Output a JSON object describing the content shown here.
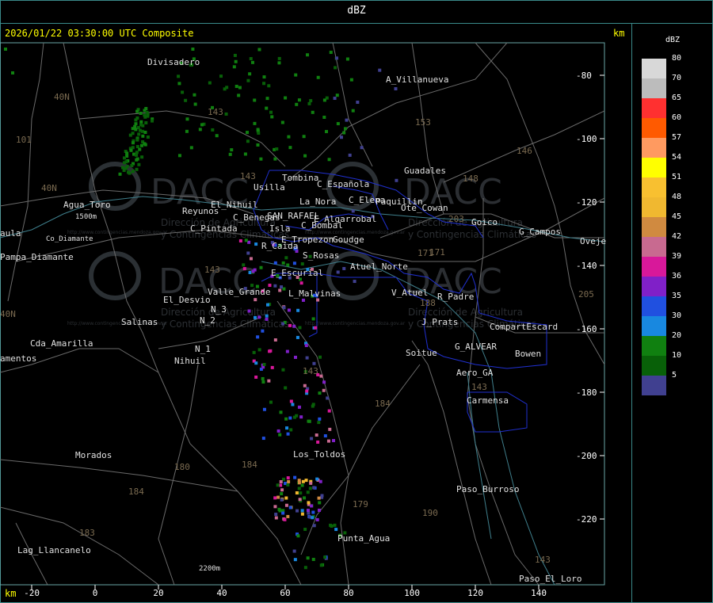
{
  "header": {
    "title": "dBZ"
  },
  "map": {
    "timestamp": "2026/01/22 03:30:00 UTC Composite",
    "km_label_top": "km",
    "km_label_bottom": "km",
    "x_ticks": [
      "-20",
      "0",
      "20",
      "40",
      "60",
      "80",
      "100",
      "120",
      "140"
    ],
    "y_ticks": [
      "-80",
      "-100",
      "-120",
      "-140",
      "-160",
      "-180",
      "-200",
      "-220"
    ],
    "watermark": {
      "brand": "DACC",
      "line1": "Dirección de Agricultura",
      "line2": "y Contingencias Climáticas",
      "url": "http://www.contingencias.mendoza.gov.ar"
    },
    "places": [
      "Divisadero",
      "A_Villanueva",
      "Guadales",
      "C_Española",
      "Usilla",
      "Tombina",
      "La_Nora",
      "C_Elena",
      "Paquillin",
      "Ote_Cowan",
      "Goico",
      "G_Campos",
      "Oveje",
      "Agua_Toro",
      "1500m",
      "Co_Diamante",
      "aula",
      "Pampa_Diamante",
      "Reyunos",
      "C_Pintada",
      "El_Nihuil",
      "C_Benegas",
      "SAN_RAFAEL",
      "E_Algarrobal",
      "C_Bombal",
      "Isla",
      "E_Tropezon",
      "Goudge",
      "R_Caida",
      "S_Rosas",
      "Atuel_Norte",
      "E_Escurial",
      "Valle_Grande",
      "L_Malvinas",
      "V_Atuel",
      "R_Padre",
      "El_Desvio",
      "N_3",
      "Salinas",
      "N_2",
      "J_Prats",
      "CompartEscard",
      "Cda_Amarilla",
      "N_1",
      "G_ALVEAR",
      "Bowen",
      "amentos",
      "Nihuil",
      "Soitue",
      "Aero_GA",
      "Carmensa",
      "Morados",
      "Los_Toldos",
      "Paso_Burroso",
      "Punta_Agua",
      "Lag_Llancanelo",
      "2200m",
      "Paso_El_Loro"
    ],
    "route_numbers": [
      "40N",
      "40N",
      "101",
      "143",
      "153",
      "146",
      "148",
      "143",
      "203",
      "171",
      "143",
      "184",
      "184",
      "180",
      "184",
      "183",
      "179",
      "190",
      "143",
      "205",
      "188",
      "171",
      "143",
      "40N",
      "143"
    ]
  },
  "legend": {
    "title": "dBZ",
    "items": [
      {
        "value": "80",
        "color": "#d8d8d8"
      },
      {
        "value": "70",
        "color": "#bcbcbc"
      },
      {
        "value": "65",
        "color": "#ff3030"
      },
      {
        "value": "60",
        "color": "#ff5a00"
      },
      {
        "value": "57",
        "color": "#ff9a60"
      },
      {
        "value": "54",
        "color": "#ffff00"
      },
      {
        "value": "51",
        "color": "#f8c030"
      },
      {
        "value": "48",
        "color": "#f0b830"
      },
      {
        "value": "45",
        "color": "#d08a40"
      },
      {
        "value": "42",
        "color": "#c86a90"
      },
      {
        "value": "39",
        "color": "#d8189a"
      },
      {
        "value": "36",
        "color": "#8020c8"
      },
      {
        "value": "35",
        "color": "#2050e0"
      },
      {
        "value": "30",
        "color": "#1888e0"
      },
      {
        "value": "20",
        "color": "#108010"
      },
      {
        "value": "10",
        "color": "#086008"
      },
      {
        "value": "5",
        "color": "#404090"
      }
    ]
  }
}
